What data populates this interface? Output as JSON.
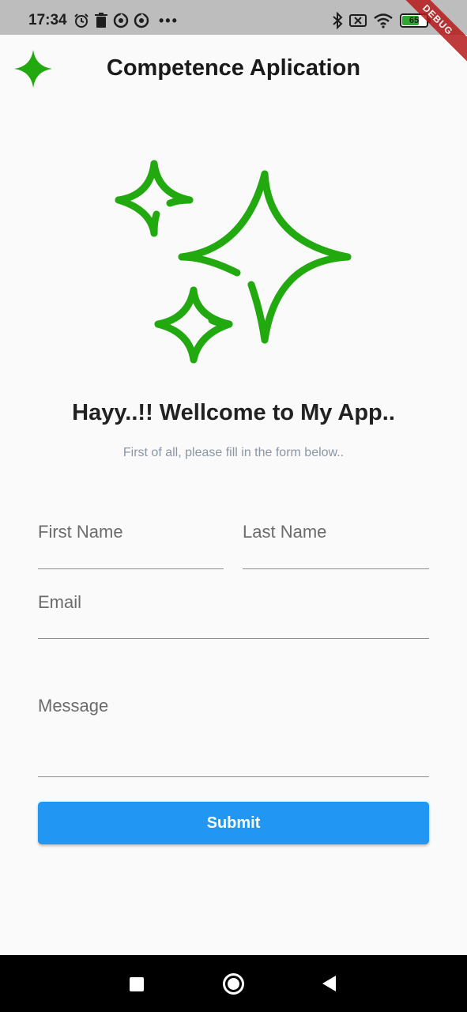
{
  "status_bar": {
    "time": "17:34",
    "battery_level": "65",
    "icons_left": [
      "alarm-icon",
      "trash-icon",
      "sync-icon",
      "sync-icon"
    ],
    "more_label": "•••",
    "icons_right": [
      "bluetooth-icon",
      "no-sim-icon",
      "wifi-icon",
      "battery-icon"
    ]
  },
  "debug_banner": "DEBUG",
  "app_bar": {
    "title": "Competence Aplication",
    "icon": "sparkle-icon"
  },
  "hero": {
    "icon": "sparkles-icon",
    "title": "Hayy..!! Wellcome to My App..",
    "subtitle": "First of all, please fill in the form below.."
  },
  "form": {
    "first_name": {
      "placeholder": "First Name",
      "value": ""
    },
    "last_name": {
      "placeholder": "Last Name",
      "value": ""
    },
    "email": {
      "placeholder": "Email",
      "value": ""
    },
    "message": {
      "placeholder": "Message",
      "value": ""
    },
    "submit_label": "Submit"
  },
  "colors": {
    "accent_green": "#22a90f",
    "button_blue": "#2196f3"
  },
  "nav_bar": {
    "icons": [
      "recents-icon",
      "home-icon",
      "back-icon"
    ]
  }
}
